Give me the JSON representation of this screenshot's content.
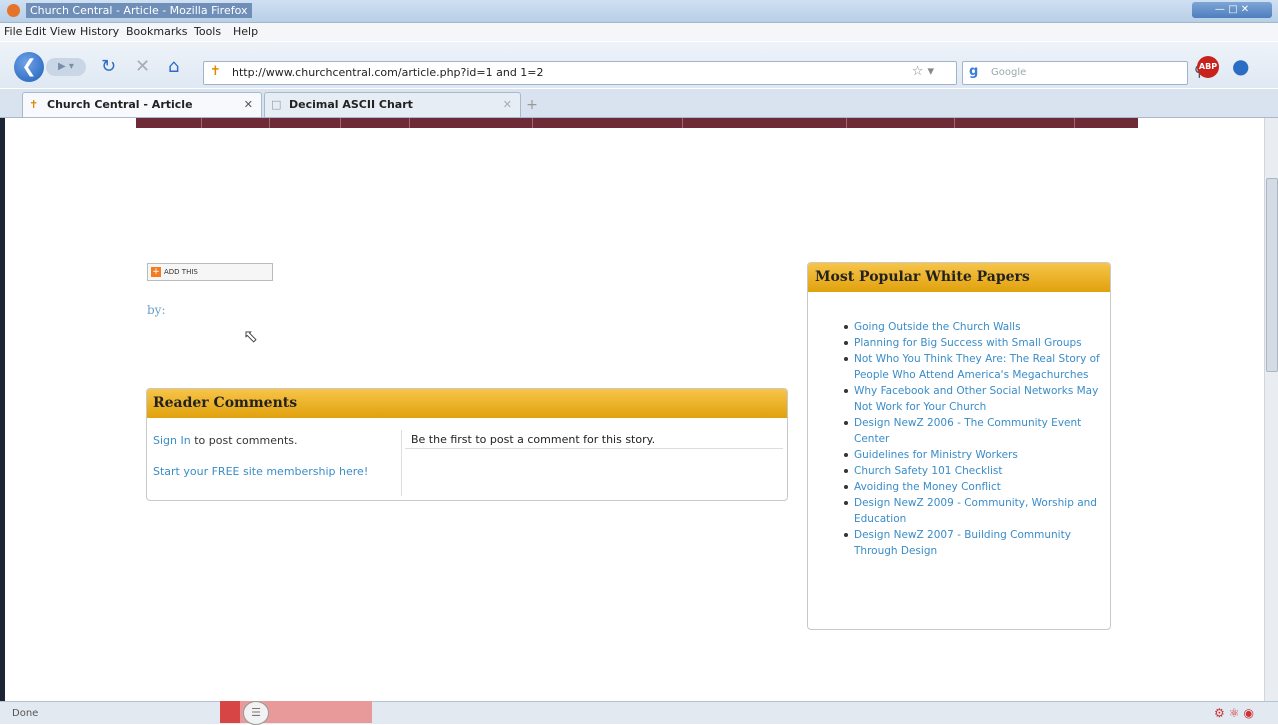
{
  "window": {
    "title": "Church Central - Article - Mozilla Firefox"
  },
  "menu": [
    "File",
    "Edit",
    "View",
    "History",
    "Bookmarks",
    "Tools",
    "Help"
  ],
  "navbar": {
    "url": "http://www.churchcentral.com/article.php?id=1 and 1=2",
    "search_placeholder": "Google"
  },
  "tabs": [
    {
      "label": "Church Central - Article",
      "active": true
    },
    {
      "label": "Decimal ASCII Chart",
      "active": false
    }
  ],
  "page": {
    "addthis_label": "ADD THIS",
    "byline": "by:",
    "comments": {
      "heading": "Reader Comments",
      "sign_in": "Sign In",
      "sign_in_suffix": " to post comments.",
      "membership": "Start your FREE site membership here!",
      "empty_message": "Be the first to post a comment for this story."
    },
    "white_papers": {
      "heading": "Most Popular White Papers",
      "items": [
        "Going Outside the Church Walls",
        "Planning for Big Success with Small Groups",
        "Not Who You Think They Are: The Real Story of People Who Attend America's Megachurches",
        "Why Facebook and Other Social Networks May Not Work for Your Church",
        "Design NewZ 2006 - The Community Event Center",
        "Guidelines for Ministry Workers",
        "Church Safety 101 Checklist",
        "Avoiding the Money Conflict",
        "Design NewZ 2009 - Community, Worship and Education",
        "Design NewZ 2007 - Building Community Through Design"
      ]
    }
  },
  "status": {
    "text": "Done"
  }
}
